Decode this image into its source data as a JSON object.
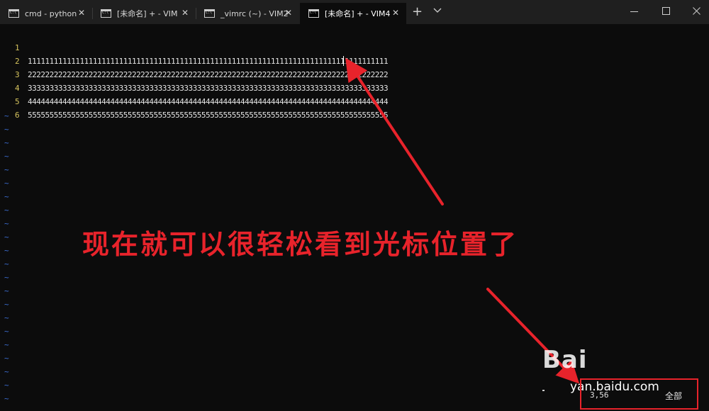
{
  "tabs": [
    {
      "label": "cmd - python",
      "active": false
    },
    {
      "label": "[未命名] + - VIM",
      "active": false
    },
    {
      "label": "_vimrc (~) - VIM2",
      "active": false
    },
    {
      "label": "[未命名] + - VIM4",
      "active": true
    }
  ],
  "editor": {
    "lines": [
      {
        "number": "1",
        "text": "11111111111111111111111111111111111111111111111111111111111111111111111111111111111"
      },
      {
        "number": "2",
        "text": "22222222222222222222222222222222222222222222222222222222222222222222222222222222222"
      },
      {
        "number": "3",
        "text": "33333333333333333333333333333333333333333333333333333333333333333333333333333333333"
      },
      {
        "number": "4",
        "text": "44444444444444444444444444444444444444444444444444444444444444444444444444444444444"
      },
      {
        "number": "5",
        "text": "55555555555555555555555555555555555555555555555555555555555555555555555555555555555"
      },
      {
        "number": "6",
        "text": ""
      }
    ],
    "empty_line_marker": "~"
  },
  "status": {
    "cursor_position": "3,56",
    "scroll_position": "全部"
  },
  "annotation": {
    "text": "现在就可以很轻松看到光标位置了",
    "color": "#e8232b"
  },
  "watermark": {
    "logo": "Bai",
    "url": "yan.baidu.com"
  },
  "colors": {
    "background": "#0c0c0c",
    "line_number": "#d6c45e",
    "tilde": "#3d6fd6",
    "tab_bar": "#1f1f1f"
  }
}
